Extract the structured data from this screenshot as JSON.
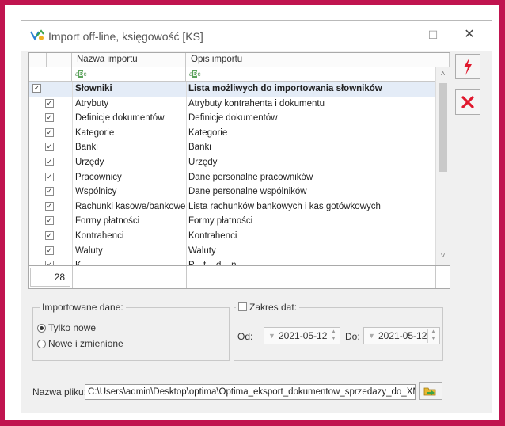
{
  "window": {
    "title": "Import off-line, księgowość [KS]",
    "minimize_glyph": "—",
    "maximize_glyph": "☐",
    "close_glyph": "✕"
  },
  "grid": {
    "columns": [
      "Nazwa importu",
      "Opis importu"
    ],
    "filter_icon": "abc-filter-icon",
    "rows": [
      {
        "name": "Słowniki",
        "desc": "Lista możliwych do importowania słowników",
        "checked": true,
        "selected": true,
        "level": 0
      },
      {
        "name": "Atrybuty",
        "desc": "Atrybuty kontrahenta i dokumentu",
        "checked": true,
        "level": 1
      },
      {
        "name": "Definicje dokumentów",
        "desc": "Definicje dokumentów",
        "checked": true,
        "level": 1
      },
      {
        "name": "Kategorie",
        "desc": "Kategorie",
        "checked": true,
        "level": 1
      },
      {
        "name": "Banki",
        "desc": "Banki",
        "checked": true,
        "level": 1
      },
      {
        "name": "Urzędy",
        "desc": "Urzędy",
        "checked": true,
        "level": 1
      },
      {
        "name": "Pracownicy",
        "desc": "Dane personalne pracowników",
        "checked": true,
        "level": 1
      },
      {
        "name": "Wspólnicy",
        "desc": "Dane personalne wspólników",
        "checked": true,
        "level": 1
      },
      {
        "name": "Rachunki kasowe/bankowe",
        "desc": "Lista rachunków bankowych i kas gotówkowych",
        "checked": true,
        "level": 1
      },
      {
        "name": "Formy płatności",
        "desc": "Formy płatności",
        "checked": true,
        "level": 1
      },
      {
        "name": "Kontrahenci",
        "desc": "Kontrahenci",
        "checked": true,
        "level": 1
      },
      {
        "name": "Waluty",
        "desc": "Waluty",
        "checked": true,
        "level": 1
      },
      {
        "name": "K...",
        "desc": "P... t... d... n...",
        "checked": true,
        "level": 1
      }
    ],
    "row_count": "28"
  },
  "side_buttons": {
    "run_icon": "lightning-icon",
    "cancel_icon": "red-x-icon"
  },
  "import_data": {
    "legend": "Importowane dane:",
    "options": [
      "Tylko nowe",
      "Nowe i zmienione"
    ],
    "selected_index": 0
  },
  "date_range": {
    "legend": "Zakres dat:",
    "checked": false,
    "from_label": "Od:",
    "from_value": "2021-05-12",
    "to_label": "Do:",
    "to_value": "2021-05-12"
  },
  "file": {
    "label": "Nazwa pliku:",
    "value": "C:\\Users\\admin\\Desktop\\optima\\Optima_eksport_dokumentow_sprzedazy_do_XML_",
    "browse_icon": "folder-open-icon"
  },
  "colors": {
    "frame": "#c0144f",
    "selection": "#e4ecf7",
    "lightning": "#e0182d",
    "cancel_x": "#e0182d"
  }
}
